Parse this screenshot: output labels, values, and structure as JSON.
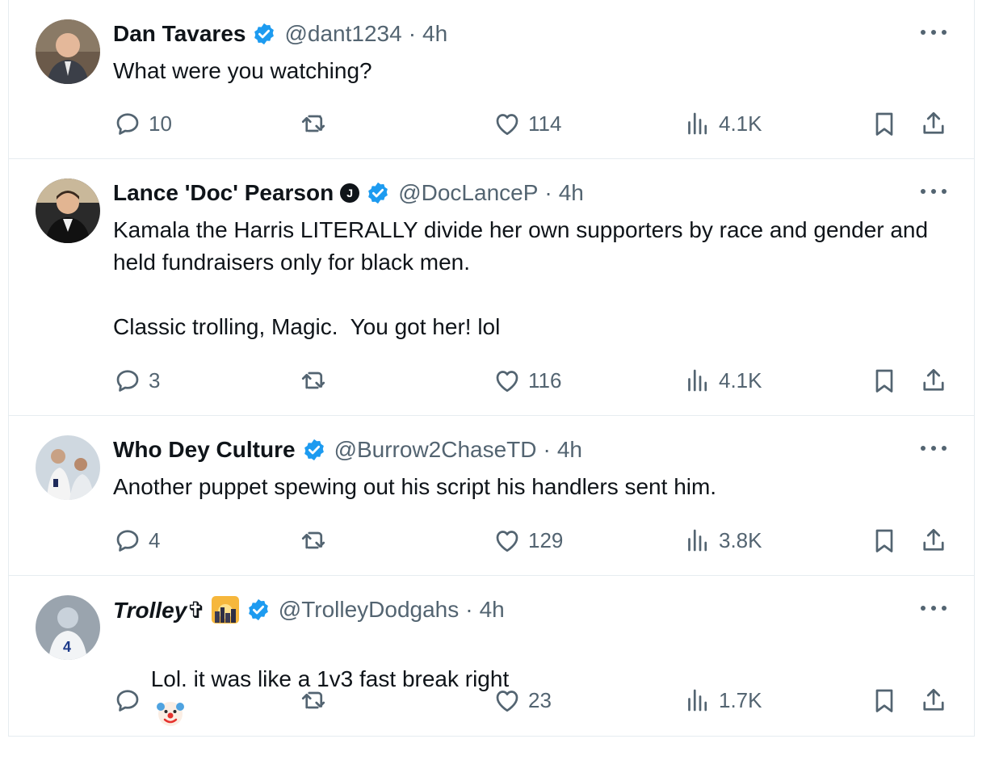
{
  "colors": {
    "accent": "#1d9bf0",
    "muted": "#536471",
    "text": "#0f1419",
    "divider": "#e6ecf0"
  },
  "tweets": [
    {
      "name": "Dan Tavares",
      "handle": "@dant1234",
      "dot": "·",
      "time": "4h",
      "text": "What were you watching?",
      "replies": "10",
      "likes": "114",
      "views": "4.1K"
    },
    {
      "name": "Lance 'Doc' Pearson",
      "handle": "@DocLanceP",
      "dot": "·",
      "time": "4h",
      "text": "Kamala the Harris LITERALLY divide her own supporters by race and gender and held fundraisers only for black men.\n\nClassic trolling, Magic.  You got her! lol",
      "replies": "3",
      "likes": "116",
      "views": "4.1K"
    },
    {
      "name": "Who Dey Culture",
      "handle": "@Burrow2ChaseTD",
      "dot": "·",
      "time": "4h",
      "text": "Another puppet spewing out his script his handlers sent him.",
      "replies": "4",
      "likes": "129",
      "views": "3.8K"
    },
    {
      "name": "Trolley✞",
      "handle": "@TrolleyDodgahs",
      "dot": "·",
      "time": "4h",
      "text": "Lol. it was like a 1v3 fast break right",
      "replies": "",
      "likes": "23",
      "views": "1.7K"
    }
  ],
  "icons": {
    "reply": "reply-icon",
    "retweet": "retweet-icon",
    "like": "heart-icon",
    "views": "views-icon",
    "bookmark": "bookmark-icon",
    "share": "share-icon",
    "more": "more-icon",
    "verified": "verified-badge-icon"
  }
}
